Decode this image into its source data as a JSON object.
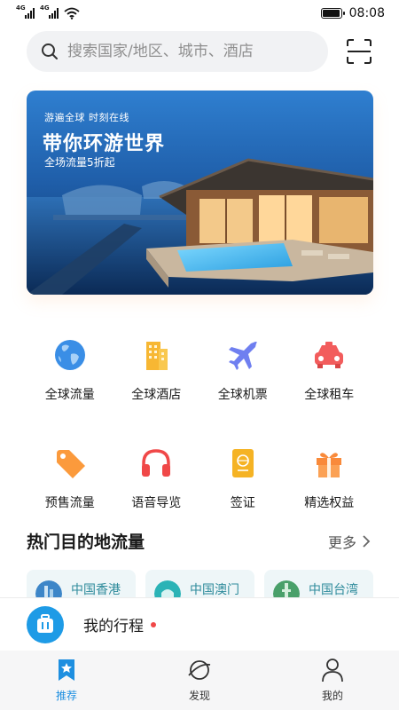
{
  "status_bar": {
    "sim1": "4G",
    "sim2": "4G",
    "time": "08:08",
    "battery_level": 0.95,
    "icons": [
      "signal-icon",
      "signal-icon",
      "wifi-icon",
      "battery-icon"
    ]
  },
  "search": {
    "placeholder": "搜索国家/地区、城市、酒店",
    "icon": "search-icon",
    "scan_icon": "scan-icon"
  },
  "banner": {
    "kicker": "游遍全球 时刻在线",
    "headline": "带你环游世界",
    "sub": "全场流量5折起"
  },
  "services": [
    {
      "label": "全球流量",
      "icon": "globe-icon"
    },
    {
      "label": "全球酒店",
      "icon": "hotel-icon"
    },
    {
      "label": "全球机票",
      "icon": "airplane-icon"
    },
    {
      "label": "全球租车",
      "icon": "car-icon"
    },
    {
      "label": "预售流量",
      "icon": "tag-icon"
    },
    {
      "label": "语音导览",
      "icon": "headphones-icon"
    },
    {
      "label": "签证",
      "icon": "passport-icon"
    },
    {
      "label": "精选权益",
      "icon": "gift-icon"
    }
  ],
  "hot": {
    "title": "热门目的地流量",
    "more": "更多",
    "destinations": [
      {
        "name": "中国香港"
      },
      {
        "name": "中国澳门"
      },
      {
        "name": "中国台湾"
      }
    ]
  },
  "trip": {
    "label": "我的行程",
    "icon": "luggage-icon"
  },
  "nav": {
    "items": [
      {
        "label": "推荐",
        "icon": "star-bookmark-icon",
        "active": true
      },
      {
        "label": "发现",
        "icon": "planet-icon",
        "active": false
      },
      {
        "label": "我的",
        "icon": "person-icon",
        "active": false
      }
    ]
  },
  "colors": {
    "accent": "#1e8fe0",
    "banner_blue": "#2a78c8",
    "trip_blue": "#1e9be6",
    "dot_red": "#f04848",
    "dest_text": "#2e8b9b"
  }
}
